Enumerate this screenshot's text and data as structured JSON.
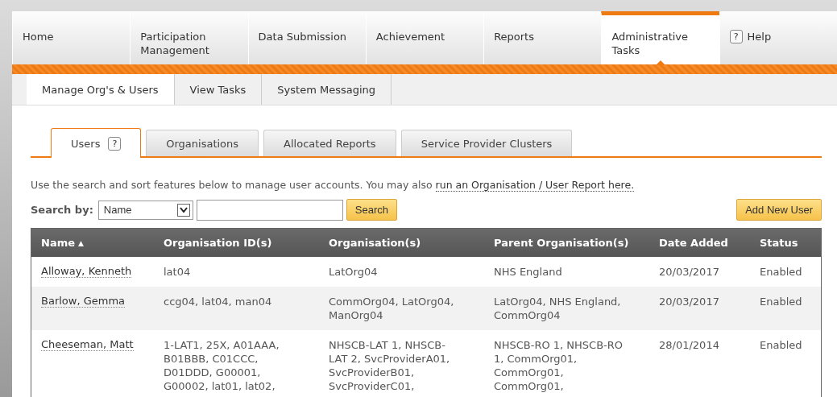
{
  "main_nav": [
    {
      "label": "Home",
      "selected": false
    },
    {
      "label": "Participation Management",
      "selected": false
    },
    {
      "label": "Data Submission",
      "selected": false
    },
    {
      "label": "Achievement",
      "selected": false
    },
    {
      "label": "Reports",
      "selected": false
    },
    {
      "label": "Administrative Tasks",
      "selected": true
    },
    {
      "label": "Help",
      "selected": false,
      "help_icon": "?"
    }
  ],
  "sub_nav": [
    {
      "label": "Manage Org's & Users",
      "selected": true
    },
    {
      "label": "View Tasks",
      "selected": false
    },
    {
      "label": "System Messaging",
      "selected": false
    }
  ],
  "section_tabs": [
    {
      "label": "Users",
      "selected": true,
      "help_icon": "?"
    },
    {
      "label": "Organisations",
      "selected": false
    },
    {
      "label": "Allocated Reports",
      "selected": false
    },
    {
      "label": "Service Provider Clusters",
      "selected": false
    }
  ],
  "intro": {
    "text": "Use the search and sort features below to manage user accounts. You may also",
    "link": "run an Organisation / User Report here."
  },
  "search": {
    "label": "Search by:",
    "field": "Name",
    "button": "Search"
  },
  "add_button": "Add New User",
  "table": {
    "columns": [
      {
        "label": "Name",
        "sort_icon": "▲"
      },
      {
        "label": "Organisation ID(s)"
      },
      {
        "label": "Organisation(s)"
      },
      {
        "label": "Parent Organisation(s)"
      },
      {
        "label": "Date Added"
      },
      {
        "label": "Status"
      }
    ],
    "rows": [
      {
        "cells": [
          "Alloway, Kenneth",
          "lat04",
          "LatOrg04",
          "NHS England",
          "20/03/2017",
          "Enabled"
        ]
      },
      {
        "cells": [
          "Barlow, Gemma",
          "ccg04, lat04, man04",
          "CommOrg04, LatOrg04, ManOrg04",
          "LatOrg04, NHS England, CommOrg04",
          "20/03/2017",
          "Enabled"
        ]
      },
      {
        "cells": [
          "Cheeseman, Matt",
          "1-LAT1, 25X, A01AAA, B01BBB, C01CCC, D01DDD, G00001, G00002, lat01, lat02,",
          "NHSCB-LAT 1, NHSCB-LAT 2, SvcProviderA01, SvcProviderB01, SvcProviderC01,",
          "NHSCB-RO 1, NHSCB-RO 1, CommOrg01, CommOrg01, CommOrg01,",
          "28/01/2014",
          "Enabled"
        ]
      }
    ]
  }
}
